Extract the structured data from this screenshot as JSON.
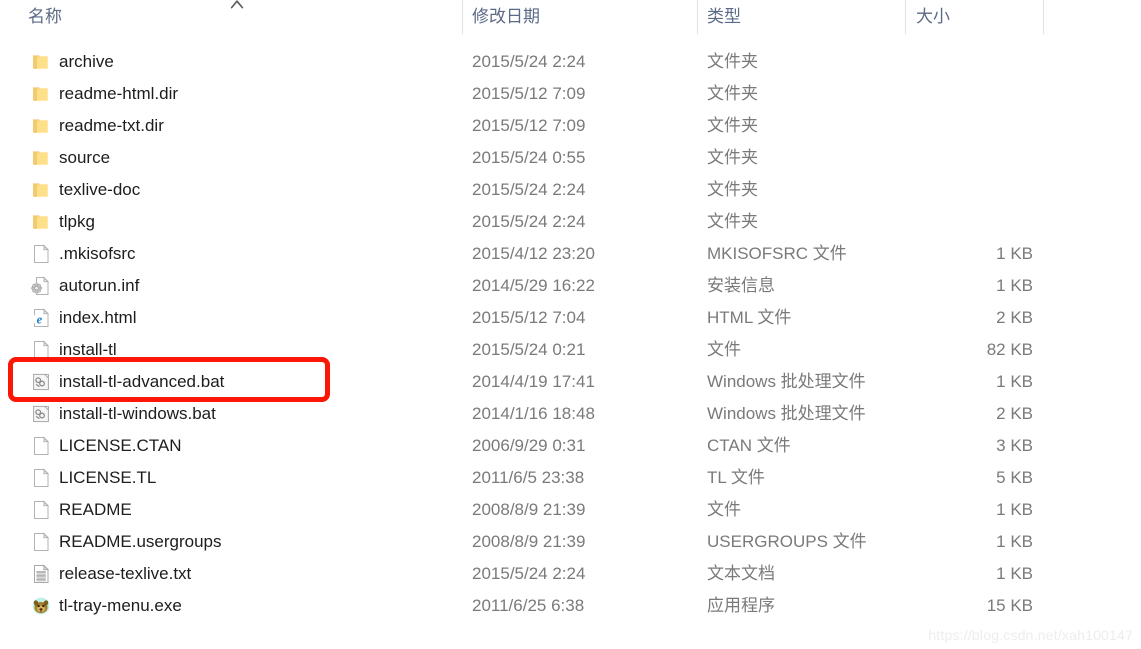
{
  "window": {
    "title": "File Explorer file list"
  },
  "columns": {
    "name": "名称",
    "date_modified": "修改日期",
    "type": "类型",
    "size": "大小",
    "sort_indicator": "ascending-caret"
  },
  "files": [
    {
      "icon": "folder-icon",
      "name": "archive",
      "date": "2015/5/24 2:24",
      "type": "文件夹",
      "size": ""
    },
    {
      "icon": "folder-icon",
      "name": "readme-html.dir",
      "date": "2015/5/12 7:09",
      "type": "文件夹",
      "size": ""
    },
    {
      "icon": "folder-icon",
      "name": "readme-txt.dir",
      "date": "2015/5/12 7:09",
      "type": "文件夹",
      "size": ""
    },
    {
      "icon": "folder-icon",
      "name": "source",
      "date": "2015/5/24 0:55",
      "type": "文件夹",
      "size": ""
    },
    {
      "icon": "folder-icon",
      "name": "texlive-doc",
      "date": "2015/5/24 2:24",
      "type": "文件夹",
      "size": ""
    },
    {
      "icon": "folder-icon",
      "name": "tlpkg",
      "date": "2015/5/24 2:24",
      "type": "文件夹",
      "size": ""
    },
    {
      "icon": "blank-file-icon",
      "name": ".mkisofsrc",
      "date": "2015/4/12 23:20",
      "type": "MKISOFSRC 文件",
      "size": "1 KB"
    },
    {
      "icon": "setup-info-icon",
      "name": "autorun.inf",
      "date": "2014/5/29 16:22",
      "type": "安装信息",
      "size": "1 KB"
    },
    {
      "icon": "ie-html-icon",
      "name": "index.html",
      "date": "2015/5/12 7:04",
      "type": "HTML 文件",
      "size": "2 KB"
    },
    {
      "icon": "blank-file-icon",
      "name": "install-tl",
      "date": "2015/5/24 0:21",
      "type": "文件",
      "size": "82 KB"
    },
    {
      "icon": "batch-file-icon",
      "name": "install-tl-advanced.bat",
      "date": "2014/4/19 17:41",
      "type": "Windows 批处理文件",
      "size": "1 KB"
    },
    {
      "icon": "batch-file-icon",
      "name": "install-tl-windows.bat",
      "date": "2014/1/16 18:48",
      "type": "Windows 批处理文件",
      "size": "2 KB"
    },
    {
      "icon": "blank-file-icon",
      "name": "LICENSE.CTAN",
      "date": "2006/9/29 0:31",
      "type": "CTAN 文件",
      "size": "3 KB"
    },
    {
      "icon": "blank-file-icon",
      "name": "LICENSE.TL",
      "date": "2011/6/5 23:38",
      "type": "TL 文件",
      "size": "5 KB"
    },
    {
      "icon": "blank-file-icon",
      "name": "README",
      "date": "2008/8/9 21:39",
      "type": "文件",
      "size": "1 KB"
    },
    {
      "icon": "blank-file-icon",
      "name": "README.usergroups",
      "date": "2008/8/9 21:39",
      "type": "USERGROUPS 文件",
      "size": "1 KB"
    },
    {
      "icon": "text-document-icon",
      "name": "release-texlive.txt",
      "date": "2015/5/24 2:24",
      "type": "文本文档",
      "size": "1 KB"
    },
    {
      "icon": "application-icon",
      "name": "tl-tray-menu.exe",
      "date": "2011/6/25 6:38",
      "type": "应用程序",
      "size": "15 KB"
    }
  ],
  "annotation": {
    "highlight_target": "install-tl-advanced.bat",
    "color": "#fb1605"
  },
  "watermark": {
    "text": "https://blog.csdn.net/xah100147"
  }
}
